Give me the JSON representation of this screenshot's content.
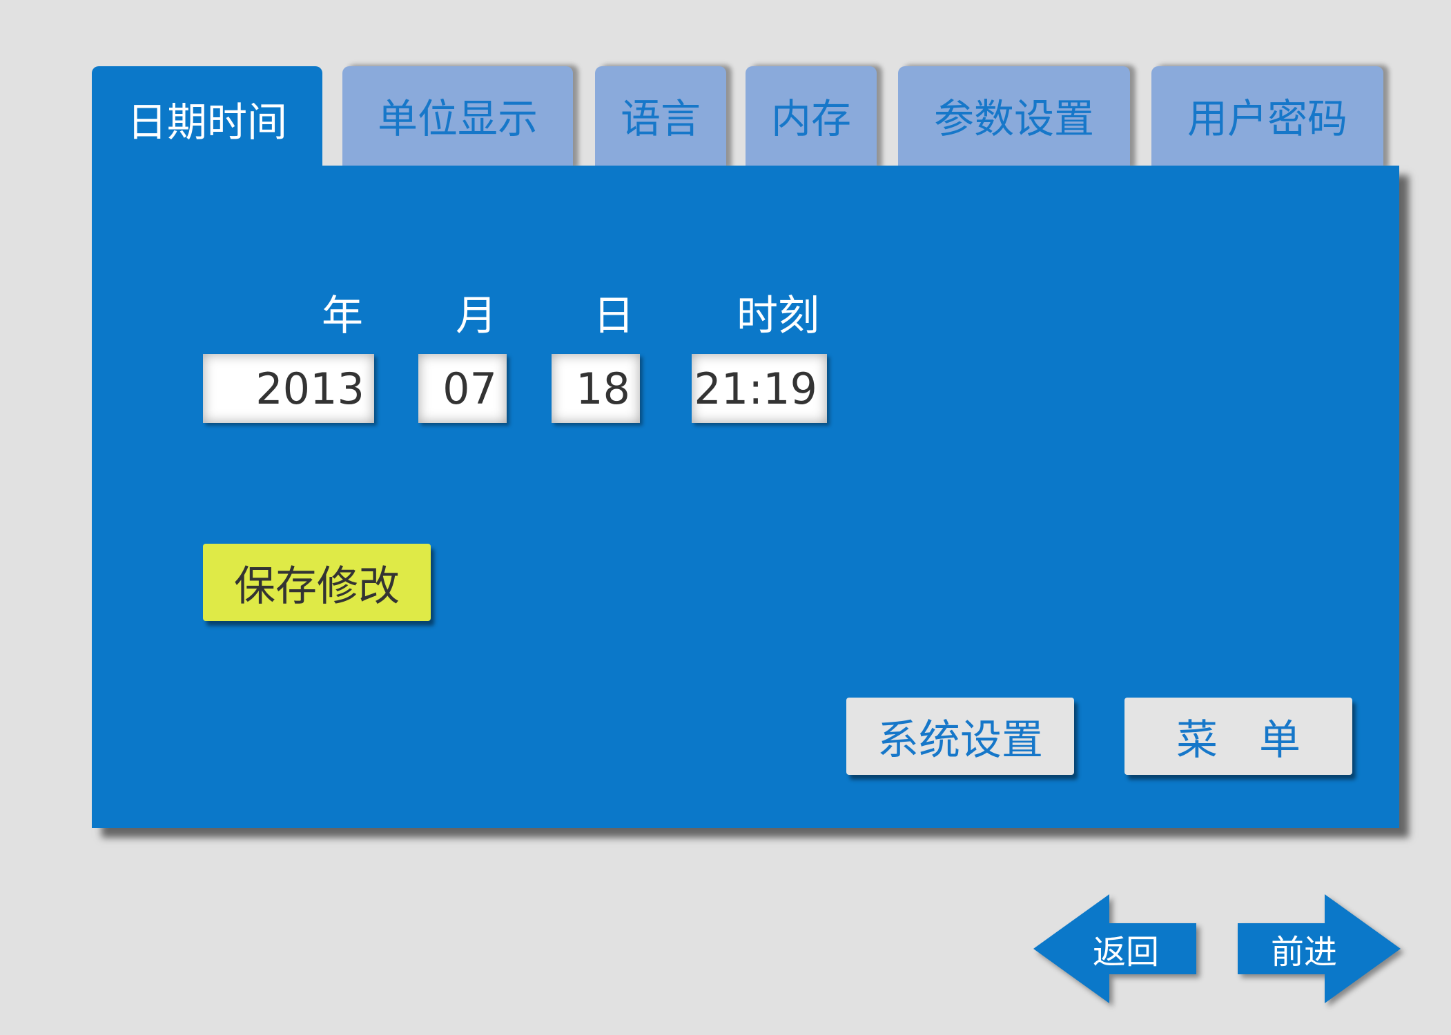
{
  "tabs": [
    {
      "label": "日期时间",
      "active": true
    },
    {
      "label": "单位显示",
      "active": false
    },
    {
      "label": "语言",
      "active": false
    },
    {
      "label": "内存",
      "active": false
    },
    {
      "label": "参数设置",
      "active": false
    },
    {
      "label": "用户密码",
      "active": false
    }
  ],
  "datetime": {
    "year_label": "年",
    "month_label": "月",
    "day_label": "日",
    "time_label": "时刻",
    "year_value": "2013",
    "month_value": "07",
    "day_value": "18",
    "time_value": "21:19"
  },
  "buttons": {
    "save": "保存修改",
    "system_settings": "系统设置",
    "menu": "菜　单"
  },
  "nav": {
    "back": "返回",
    "forward": "前进"
  },
  "colors": {
    "background": "#e1e1e1",
    "panel": "#0b78c9",
    "tab_inactive": "#8aaadb",
    "accent_text": "#1677c9",
    "save_button": "#dfea47",
    "secondary_button": "#e4e4e4"
  }
}
